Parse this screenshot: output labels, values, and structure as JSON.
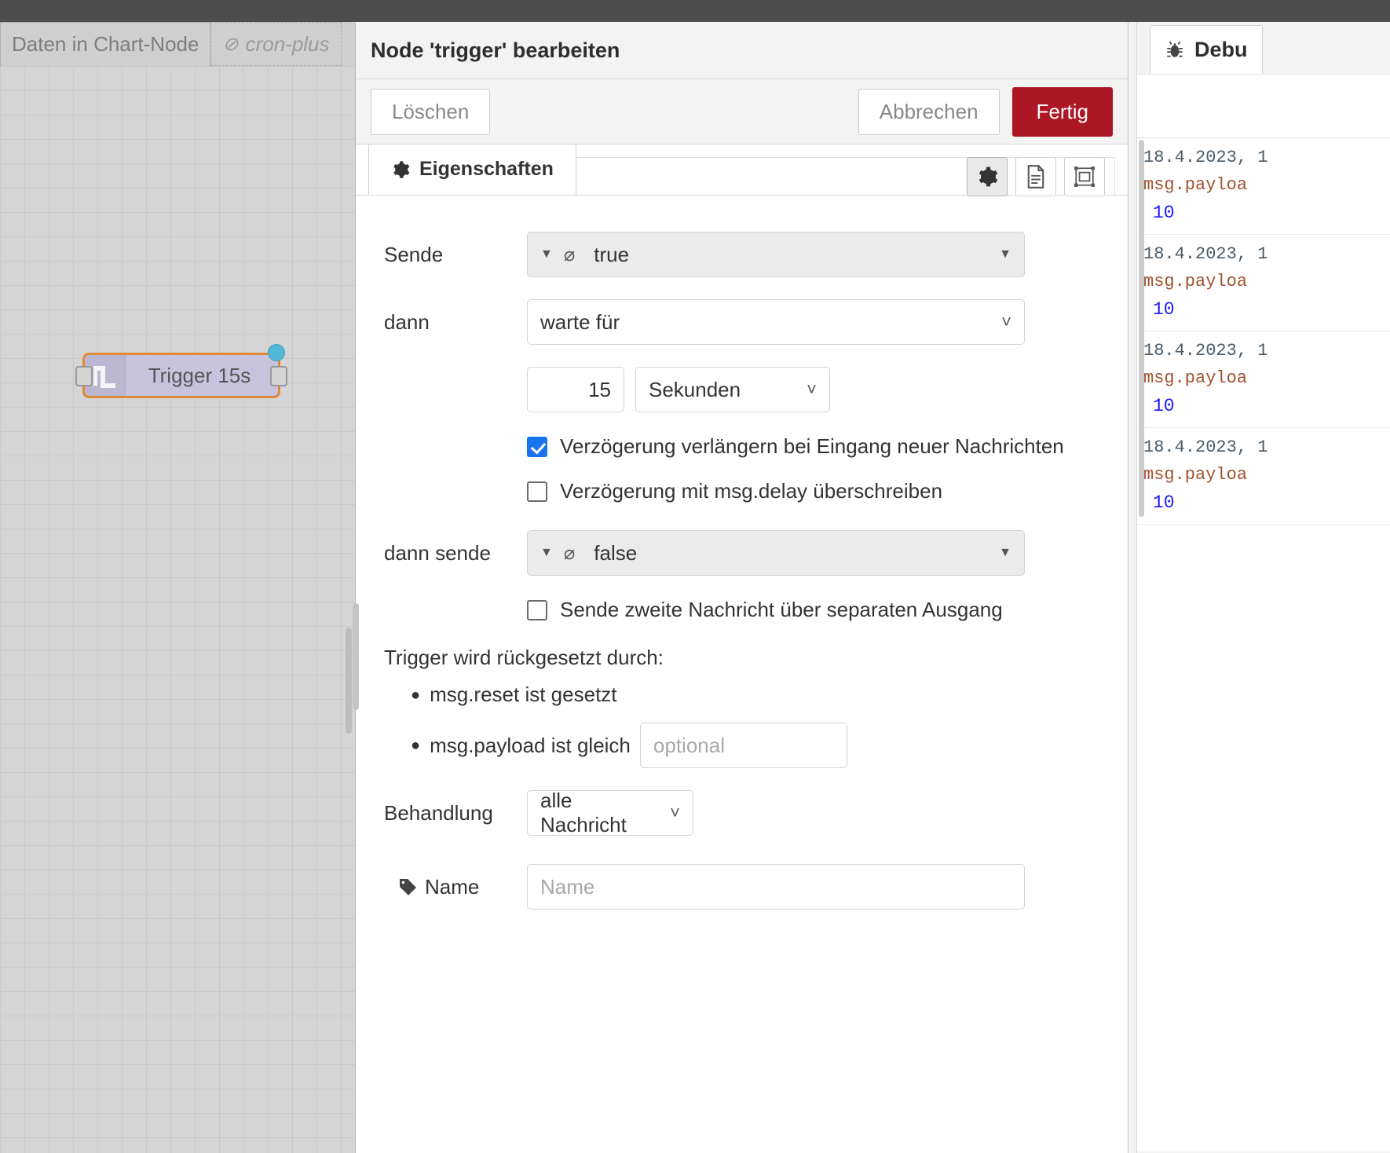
{
  "workspace": {
    "tabs": [
      {
        "label": "Daten in Chart-Node",
        "state": "active"
      },
      {
        "label": "cron-plus",
        "state": "disabled",
        "icon": "no-entry-icon"
      }
    ],
    "node": {
      "label": "Trigger 15s",
      "icon": "pulse-icon",
      "selected_border_color": "#e08a38",
      "body_color": "#c7c3dd",
      "changed_indicator_color": "#53b7d8"
    }
  },
  "dialog": {
    "title": "Node 'trigger' bearbeiten",
    "buttons": {
      "delete": "Löschen",
      "cancel": "Abbrechen",
      "done": "Fertig"
    },
    "accent_color": "#ad1625",
    "tabs": [
      {
        "label": "Eigenschaften",
        "icon": "gear-icon",
        "active": true
      }
    ],
    "toolbar_icons": [
      {
        "name": "gear-icon",
        "active": true
      },
      {
        "name": "description-icon",
        "active": false
      },
      {
        "name": "appearance-icon",
        "active": false
      }
    ],
    "form": {
      "send_label": "Sende",
      "send_value": "true",
      "send_type_icon": "boolean-icon",
      "then_label": "dann",
      "then_value": "warte für",
      "duration_value": "15",
      "duration_unit": "Sekunden",
      "extend_delay_label": "Verzögerung verlängern bei Eingang neuer Nachrichten",
      "extend_delay_checked": true,
      "override_delay_label": "Verzögerung mit msg.delay überschreiben",
      "override_delay_checked": false,
      "then_send_label": "dann sende",
      "then_send_value": "false",
      "then_send_type_icon": "boolean-icon",
      "second_output_label": "Sende zweite Nachricht über separaten Ausgang",
      "second_output_checked": false,
      "reset_title": "Trigger wird rückgesetzt durch:",
      "reset_items": [
        {
          "text": "msg.reset ist gesetzt"
        },
        {
          "text": "msg.payload ist gleich",
          "input_placeholder": "optional",
          "input_value": ""
        }
      ],
      "handling_label": "Behandlung",
      "handling_value": "alle Nachricht",
      "name_label": "Name",
      "name_icon": "tag-icon",
      "name_placeholder": "Name",
      "name_value": ""
    }
  },
  "sidebar": {
    "tab_label": "Debu",
    "tab_icon": "bug-icon",
    "messages": [
      {
        "time": "18.4.2023, 1",
        "topic": "msg.payloa",
        "value": "10"
      },
      {
        "time": "18.4.2023, 1",
        "topic": "msg.payloa",
        "value": "10"
      },
      {
        "time": "18.4.2023, 1",
        "topic": "msg.payloa",
        "value": "10"
      },
      {
        "time": "18.4.2023, 1",
        "topic": "msg.payloa",
        "value": "10"
      }
    ],
    "value_color": "#1a1aff",
    "topic_color": "#a0522d"
  }
}
